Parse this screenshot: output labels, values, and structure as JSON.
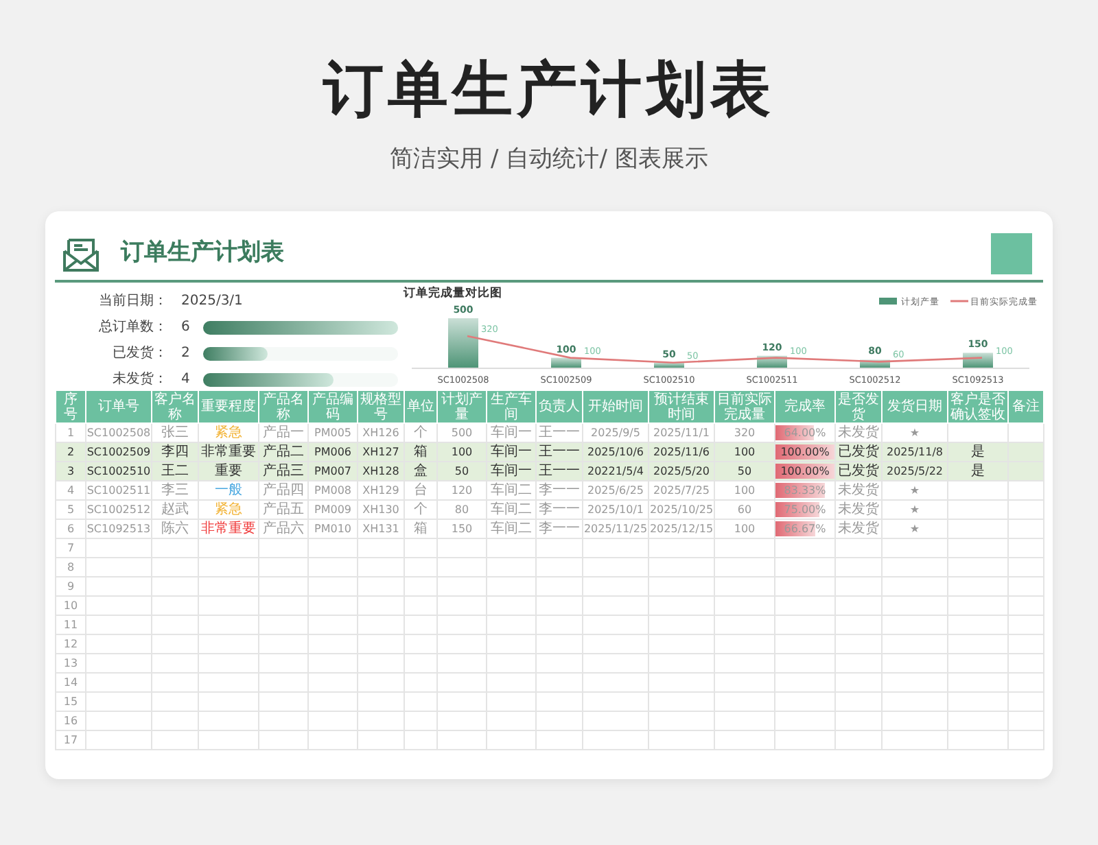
{
  "page_title": "订单生产计划表",
  "subtitle": "简洁实用 / 自动统计/ 图表展示",
  "card": {
    "title": "订单生产计划表",
    "summary": {
      "date_label": "当前日期：",
      "date": "2025/3/1",
      "stats": [
        {
          "label": "总订单数：",
          "value": "6",
          "level": 1
        },
        {
          "label": "已发货：",
          "value": "2",
          "level": 0.33
        },
        {
          "label": "未发货：",
          "value": "4",
          "level": 0.67
        }
      ]
    },
    "chart": {
      "chart_data": {
        "type": "bar",
        "title": "订单完成量对比图",
        "categories": [
          "SC1002508",
          "SC1002509",
          "SC1002510",
          "SC1002511",
          "SC1002512",
          "SC1092513"
        ],
        "data_labels": true,
        "legend": "top-right",
        "series": [
          {
            "name": "计划产量",
            "type": "bar",
            "color": "#4f9577",
            "values": [
              500,
              100,
              50,
              120,
              80,
              150
            ]
          },
          {
            "name": "目前实际完成量",
            "type": "line",
            "color": "#e07a7a",
            "values": [
              320,
              100,
              50,
              100,
              60,
              100
            ]
          }
        ]
      }
    },
    "table": {
      "columns": [
        "序号",
        "订单号",
        "客户名称",
        "重要程度",
        "产品名称",
        "产品编码",
        "规格型号",
        "单位",
        "计划产量",
        "生产车间",
        "负责人",
        "开始时间",
        "预计结束时间",
        "目前实际完成量",
        "完成率",
        "是否发货",
        "发货日期",
        "客户是否确认签收",
        "备注"
      ],
      "rows": [
        {
          "no": "1",
          "order": "SC1002508",
          "customer": "张三",
          "priority": {
            "text": "紧急",
            "color": "#f2b233"
          },
          "product": "产品一",
          "code": "PM005",
          "spec": "XH126",
          "unit": "个",
          "planned": "500",
          "workshop": "车间一",
          "owner": "王一一",
          "start": "2025/9/5",
          "end": "2025/11/1",
          "actual": "320",
          "rate": {
            "text": "64.00%",
            "level": 0.64
          },
          "shipped": "未发货",
          "ship_date": "★",
          "highlighted": false
        },
        {
          "no": "2",
          "order": "SC1002509",
          "customer": "李四",
          "priority": {
            "text": "非常重要",
            "color": "#333333"
          },
          "product": "产品二",
          "code": "PM006",
          "spec": "XH127",
          "unit": "箱",
          "planned": "100",
          "workshop": "车间一",
          "owner": "王一一",
          "start": "2025/10/6",
          "end": "2025/11/6",
          "actual": "100",
          "rate": {
            "text": "100.00%",
            "level": 1
          },
          "shipped": "已发货",
          "ship_date": "2025/11/8",
          "signed": "是",
          "highlighted": true
        },
        {
          "no": "3",
          "order": "SC1002510",
          "customer": "王二",
          "priority": {
            "text": "重要",
            "color": "#333333"
          },
          "product": "产品三",
          "code": "PM007",
          "spec": "XH128",
          "unit": "盒",
          "planned": "50",
          "workshop": "车间一",
          "owner": "王一一",
          "start": "20221/5/4",
          "end": "2025/5/20",
          "actual": "50",
          "rate": {
            "text": "100.00%",
            "level": 1
          },
          "shipped": "已发货",
          "ship_date": "2025/5/22",
          "signed": "是",
          "highlighted": true
        },
        {
          "no": "4",
          "order": "SC1002511",
          "customer": "李三",
          "priority": {
            "text": "一般",
            "color": "#4aa8e0"
          },
          "product": "产品四",
          "code": "PM008",
          "spec": "XH129",
          "unit": "台",
          "planned": "120",
          "workshop": "车间二",
          "owner": "李一一",
          "start": "2025/6/25",
          "end": "2025/7/25",
          "actual": "100",
          "rate": {
            "text": "83.33%",
            "level": 0.8333
          },
          "shipped": "未发货",
          "ship_date": "★",
          "highlighted": false
        },
        {
          "no": "5",
          "order": "SC1002512",
          "customer": "赵武",
          "priority": {
            "text": "紧急",
            "color": "#f2b233"
          },
          "product": "产品五",
          "code": "PM009",
          "spec": "XH130",
          "unit": "个",
          "planned": "80",
          "workshop": "车间二",
          "owner": "李一一",
          "start": "2025/10/1",
          "end": "2025/10/25",
          "actual": "60",
          "rate": {
            "text": "75.00%",
            "level": 0.75
          },
          "shipped": "未发货",
          "ship_date": "★",
          "highlighted": false
        },
        {
          "no": "6",
          "order": "SC1092513",
          "customer": "陈六",
          "priority": {
            "text": "非常重要",
            "color": "#f03a3a"
          },
          "product": "产品六",
          "code": "PM010",
          "spec": "XH131",
          "unit": "箱",
          "planned": "150",
          "workshop": "车间二",
          "owner": "李一一",
          "start": "2025/11/25",
          "end": "2025/12/15",
          "actual": "100",
          "rate": {
            "text": "66.67%",
            "level": 0.6667
          },
          "shipped": "未发货",
          "ship_date": "★",
          "highlighted": false
        },
        {
          "no": "7"
        },
        {
          "no": "8"
        },
        {
          "no": "9"
        },
        {
          "no": "10"
        },
        {
          "no": "11"
        },
        {
          "no": "12"
        },
        {
          "no": "13"
        },
        {
          "no": "14"
        },
        {
          "no": "15"
        },
        {
          "no": "16"
        },
        {
          "no": "17"
        }
      ]
    }
  }
}
